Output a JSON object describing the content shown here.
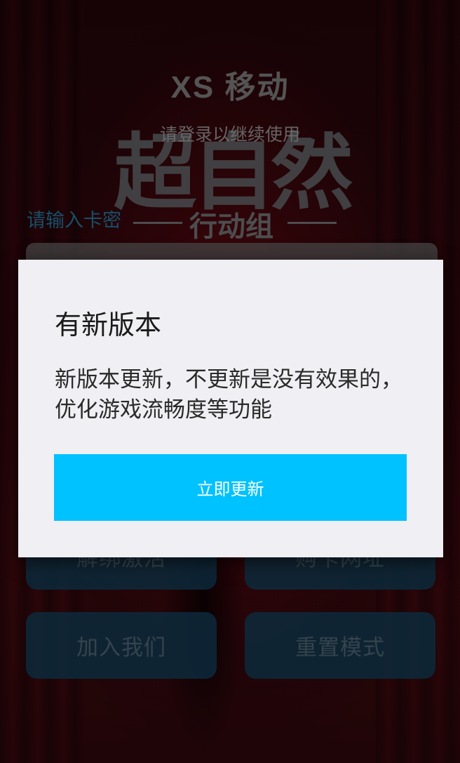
{
  "app": {
    "title": "XS 移动",
    "logo_main": "超自然",
    "logo_sub": "行动组",
    "login_hint": "请登录以继续使用"
  },
  "card": {
    "label": "请输入卡密"
  },
  "buttons": [
    {
      "label": "解绑激活"
    },
    {
      "label": "购卡网址"
    },
    {
      "label": "加入我们"
    },
    {
      "label": "重置模式"
    }
  ],
  "dialog": {
    "title": "有新版本",
    "message": "新版本更新，不更新是没有效果的，优化游戏流畅度等功能",
    "button_label": "立即更新"
  },
  "colors": {
    "dialog_bg": "#efeff4",
    "accent": "#00c2ff",
    "label_blue": "#2c8fbd",
    "button_bg": "#184c6c"
  }
}
